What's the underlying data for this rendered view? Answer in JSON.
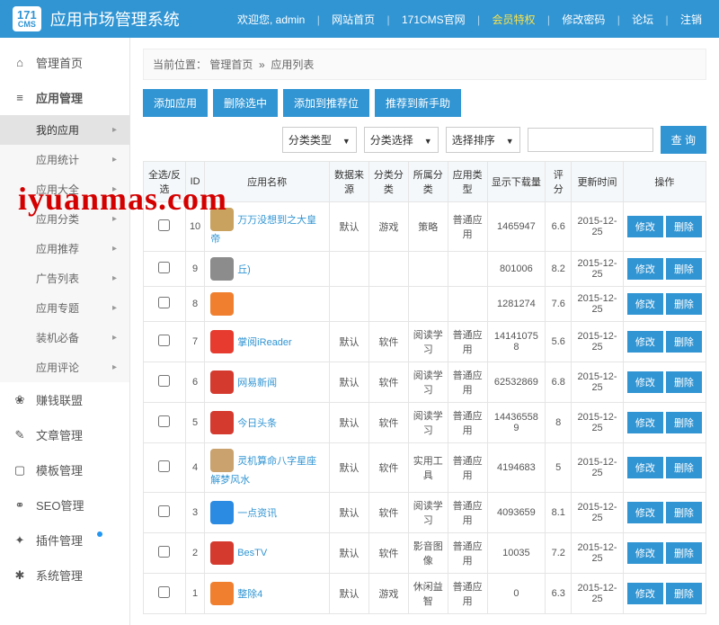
{
  "header": {
    "logo_top": "171",
    "logo_sub": "CMS",
    "title": "应用市场管理系统",
    "welcome": "欢迎您, admin",
    "links": [
      "网站首页",
      "171CMS官网",
      "会员特权",
      "修改密码",
      "论坛",
      "注销"
    ]
  },
  "sidebar": {
    "items": [
      {
        "icon": "home",
        "label": "管理首页"
      },
      {
        "icon": "menu",
        "label": "应用管理",
        "active": true,
        "children": [
          {
            "label": "我的应用",
            "selected": true
          },
          {
            "label": "应用统计"
          },
          {
            "label": "应用大全"
          },
          {
            "label": "应用分类"
          },
          {
            "label": "应用推荐"
          },
          {
            "label": "广告列表"
          },
          {
            "label": "应用专题"
          },
          {
            "label": "装机必备"
          },
          {
            "label": "应用评论"
          }
        ]
      },
      {
        "icon": "money",
        "label": "赚钱联盟"
      },
      {
        "icon": "doc",
        "label": "文章管理"
      },
      {
        "icon": "tpl",
        "label": "模板管理"
      },
      {
        "icon": "seo",
        "label": "SEO管理"
      },
      {
        "icon": "plugin",
        "label": "插件管理",
        "dot": true
      },
      {
        "icon": "gear",
        "label": "系统管理"
      }
    ]
  },
  "breadcrumb": {
    "prefix": "当前位置：",
    "parts": [
      "管理首页",
      "应用列表"
    ]
  },
  "toolbar": {
    "buttons": [
      "添加应用",
      "删除选中",
      "添加到推荐位",
      "推荐到新手助"
    ]
  },
  "filters": {
    "selects": [
      "分类类型",
      "分类选择",
      "选择排序"
    ],
    "search_placeholder": "",
    "search_btn": "查 询"
  },
  "table": {
    "headers": [
      "全选/反选",
      "ID",
      "应用名称",
      "数据来源",
      "分类分类",
      "所属分类",
      "应用类型",
      "显示下载量",
      "评分",
      "更新时间",
      "操作"
    ],
    "ops": {
      "edit": "修改",
      "del": "删除"
    },
    "rows": [
      {
        "id": "10",
        "icon": "#c9a25f",
        "name": "万万没想到之大皇帝",
        "source": "默认",
        "cat1": "游戏",
        "cat2": "策略",
        "type": "普通应用",
        "downloads": "1465947",
        "rating": "6.6",
        "date": "2015-12-25"
      },
      {
        "id": "9",
        "icon": "#8c8c8c",
        "name": "丘)",
        "source": "",
        "cat1": "",
        "cat2": "",
        "type": "",
        "downloads": "801006",
        "rating": "8.2",
        "date": "2015-12-25"
      },
      {
        "id": "8",
        "icon": "#f08030",
        "name": "",
        "source": "",
        "cat1": "",
        "cat2": "",
        "type": "",
        "downloads": "1281274",
        "rating": "7.6",
        "date": "2015-12-25"
      },
      {
        "id": "7",
        "icon": "#e63b2e",
        "name": "掌阅iReader",
        "source": "默认",
        "cat1": "软件",
        "cat2": "阅读学习",
        "type": "普通应用",
        "downloads": "14141075 8",
        "rating": "5.6",
        "date": "2015-12-25"
      },
      {
        "id": "6",
        "icon": "#d53a2f",
        "name": "网易新闻",
        "source": "默认",
        "cat1": "软件",
        "cat2": "阅读学习",
        "type": "普通应用",
        "downloads": "62532869",
        "rating": "6.8",
        "date": "2015-12-25"
      },
      {
        "id": "5",
        "icon": "#d53a2f",
        "name": "今日头条",
        "source": "默认",
        "cat1": "软件",
        "cat2": "阅读学习",
        "type": "普通应用",
        "downloads": "14436558 9",
        "rating": "8",
        "date": "2015-12-25"
      },
      {
        "id": "4",
        "icon": "#caa26e",
        "name": "灵机算命八字星座解梦风水",
        "source": "默认",
        "cat1": "软件",
        "cat2": "实用工具",
        "type": "普通应用",
        "downloads": "4194683",
        "rating": "5",
        "date": "2015-12-25"
      },
      {
        "id": "3",
        "icon": "#2b8ae2",
        "name": "一点资讯",
        "source": "默认",
        "cat1": "软件",
        "cat2": "阅读学习",
        "type": "普通应用",
        "downloads": "4093659",
        "rating": "8.1",
        "date": "2015-12-25"
      },
      {
        "id": "2",
        "icon": "#d53a2f",
        "name": "BesTV",
        "source": "默认",
        "cat1": "软件",
        "cat2": "影音图像",
        "type": "普通应用",
        "downloads": "10035",
        "rating": "7.2",
        "date": "2015-12-25"
      },
      {
        "id": "1",
        "icon": "#f08030",
        "name": "整除4",
        "source": "默认",
        "cat1": "游戏",
        "cat2": "休闲益智",
        "type": "普通应用",
        "downloads": "0",
        "rating": "6.3",
        "date": "2015-12-25"
      }
    ]
  },
  "watermark": "iyuanmas.com"
}
